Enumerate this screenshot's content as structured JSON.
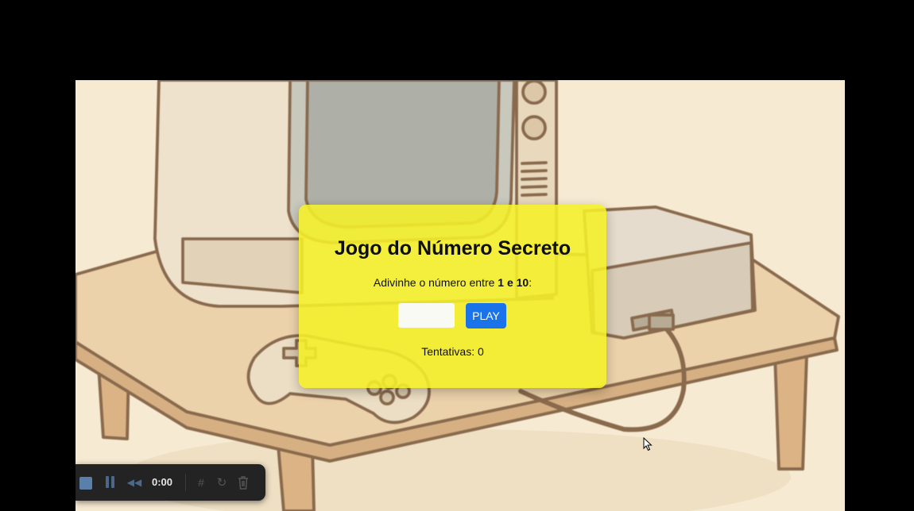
{
  "game": {
    "title": "Jogo do Número Secreto",
    "instruction_prefix": "Adivinhe o número entre ",
    "instruction_range": "1 e 10",
    "instruction_suffix": ":",
    "input_value": "",
    "play_label": "PLAY",
    "attempts_text": "Tentativas: 0"
  },
  "recorder": {
    "time": "0:00",
    "icons": [
      "stop-icon",
      "pause-icon",
      "rewind-icon",
      "grid-icon",
      "restart-icon",
      "trash-icon"
    ]
  },
  "colors": {
    "card_bg": "#f5f028",
    "button_bg": "#1a73e8",
    "scene_bg": "#f6ead3",
    "recorder_bg": "#232323"
  }
}
